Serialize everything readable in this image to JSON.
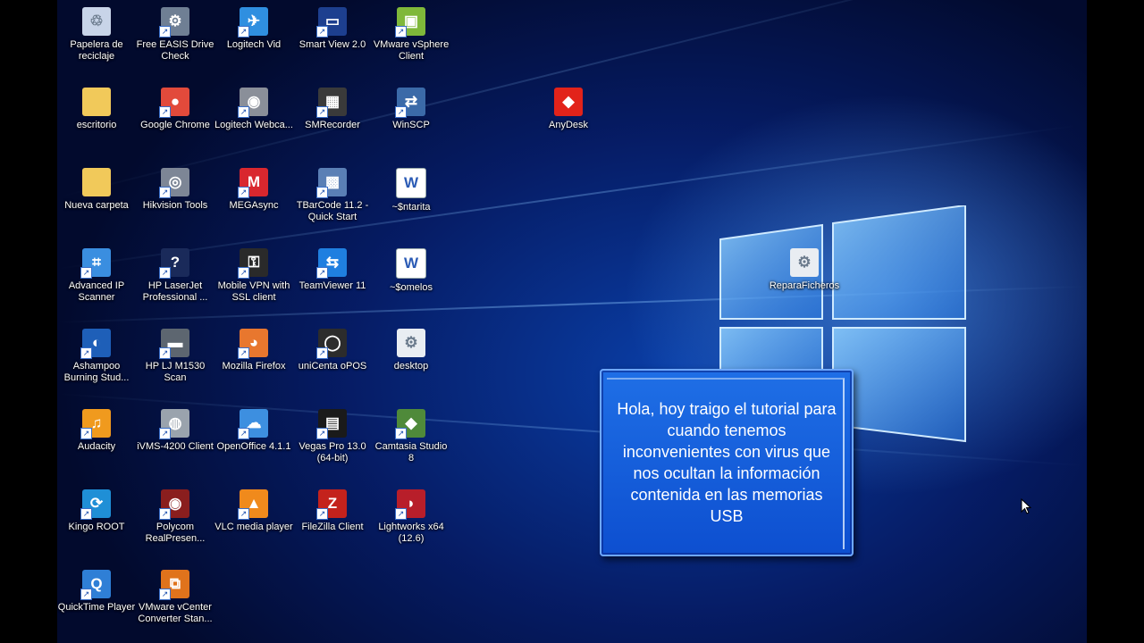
{
  "desktop": {
    "icons": [
      {
        "label": "Papelera de reciclaje",
        "icon": "recycle-bin-icon",
        "color": "#c8d4e8",
        "glyph": "♲",
        "shortcut": false
      },
      {
        "label": "Free EASIS Drive Check",
        "icon": "drive-check-icon",
        "color": "#6f7f94",
        "glyph": "⚙",
        "shortcut": true
      },
      {
        "label": "Logitech Vid",
        "icon": "logitech-vid-icon",
        "color": "#2f8fe0",
        "glyph": "✈",
        "shortcut": true
      },
      {
        "label": "Smart View 2.0",
        "icon": "smart-view-icon",
        "color": "#1d3f8f",
        "glyph": "▭",
        "shortcut": true
      },
      {
        "label": "VMware vSphere Client",
        "icon": "vsphere-icon",
        "color": "#7fb83a",
        "glyph": "▣",
        "shortcut": true
      },
      {
        "label": "escritorio",
        "icon": "folder-icon",
        "color": "#f1c95a",
        "glyph": "",
        "shortcut": false
      },
      {
        "label": "Google Chrome",
        "icon": "chrome-icon",
        "color": "#e24a3b",
        "glyph": "●",
        "shortcut": true
      },
      {
        "label": "Logitech Webca...",
        "icon": "webcam-icon",
        "color": "#8a8f99",
        "glyph": "◉",
        "shortcut": true
      },
      {
        "label": "SMRecorder",
        "icon": "smrecorder-icon",
        "color": "#3a3a3a",
        "glyph": "▦",
        "shortcut": true
      },
      {
        "label": "WinSCP",
        "icon": "winscp-icon",
        "color": "#3b6aa8",
        "glyph": "⇄",
        "shortcut": true
      },
      {
        "label": "Nueva carpeta",
        "icon": "folder-icon",
        "color": "#f1c95a",
        "glyph": "",
        "shortcut": false
      },
      {
        "label": "Hikvision Tools",
        "icon": "hikvision-icon",
        "color": "#7d8696",
        "glyph": "◎",
        "shortcut": true
      },
      {
        "label": "MEGAsync",
        "icon": "mega-icon",
        "color": "#d9272e",
        "glyph": "M",
        "shortcut": true
      },
      {
        "label": "TBarCode 11.2 - Quick Start",
        "icon": "barcode-icon",
        "color": "#5a7fb5",
        "glyph": "▩",
        "shortcut": true
      },
      {
        "label": "~$ntarita",
        "icon": "word-doc-icon",
        "color": "#ffffff",
        "glyph": "W",
        "shortcut": false
      },
      {
        "label": "Advanced IP Scanner",
        "icon": "ip-scanner-icon",
        "color": "#3a8ee0",
        "glyph": "⌗",
        "shortcut": true
      },
      {
        "label": "HP LaserJet Professional ...",
        "icon": "hp-laserjet-icon",
        "color": "#1a2a5a",
        "glyph": "?",
        "shortcut": true
      },
      {
        "label": "Mobile VPN with SSL client",
        "icon": "vpn-icon",
        "color": "#2a2a2a",
        "glyph": "⚿",
        "shortcut": true
      },
      {
        "label": "TeamViewer 11",
        "icon": "teamviewer-icon",
        "color": "#1f7fe0",
        "glyph": "⇆",
        "shortcut": true
      },
      {
        "label": "~$omelos",
        "icon": "word-doc-icon",
        "color": "#ffffff",
        "glyph": "W",
        "shortcut": false
      },
      {
        "label": "Ashampoo Burning Stud...",
        "icon": "ashampoo-icon",
        "color": "#1e5fb8",
        "glyph": "◐",
        "shortcut": true
      },
      {
        "label": "HP LJ M1530 Scan",
        "icon": "hp-scan-icon",
        "color": "#5d6670",
        "glyph": "▬",
        "shortcut": true
      },
      {
        "label": "Mozilla Firefox",
        "icon": "firefox-icon",
        "color": "#e8772e",
        "glyph": "◕",
        "shortcut": true
      },
      {
        "label": "uniCenta oPOS",
        "icon": "unicenta-icon",
        "color": "#2c2c2c",
        "glyph": "◯",
        "shortcut": true
      },
      {
        "label": "desktop",
        "icon": "settings-file-icon",
        "color": "#e9edf2",
        "glyph": "⚙",
        "shortcut": false
      },
      {
        "label": "Audacity",
        "icon": "audacity-icon",
        "color": "#f09a1e",
        "glyph": "♫",
        "shortcut": true
      },
      {
        "label": "iVMS-4200 Client",
        "icon": "ivms-icon",
        "color": "#9aa3ad",
        "glyph": "◍",
        "shortcut": true
      },
      {
        "label": "OpenOffice 4.1.1",
        "icon": "openoffice-icon",
        "color": "#3d8fe0",
        "glyph": "☁",
        "shortcut": true
      },
      {
        "label": "Vegas Pro 13.0 (64-bit)",
        "icon": "vegas-icon",
        "color": "#1a1a1a",
        "glyph": "▤",
        "shortcut": true
      },
      {
        "label": "Camtasia Studio 8",
        "icon": "camtasia-icon",
        "color": "#4f8a3a",
        "glyph": "◆",
        "shortcut": true
      },
      {
        "label": "Kingo ROOT",
        "icon": "kingo-root-icon",
        "color": "#1f8fd6",
        "glyph": "⟳",
        "shortcut": true
      },
      {
        "label": "Polycom RealPresen...",
        "icon": "polycom-icon",
        "color": "#8a1e1e",
        "glyph": "◉",
        "shortcut": true
      },
      {
        "label": "VLC media player",
        "icon": "vlc-icon",
        "color": "#f08a1c",
        "glyph": "▲",
        "shortcut": true
      },
      {
        "label": "FileZilla Client",
        "icon": "filezilla-icon",
        "color": "#c4221c",
        "glyph": "Z",
        "shortcut": true
      },
      {
        "label": "Lightworks x64 (12.6)",
        "icon": "lightworks-icon",
        "color": "#b81e2a",
        "glyph": "◗",
        "shortcut": true
      },
      {
        "label": "QuickTime Player",
        "icon": "quicktime-icon",
        "color": "#2f7fd6",
        "glyph": "Q",
        "shortcut": true
      },
      {
        "label": "VMware vCenter Converter Stan...",
        "icon": "vcenter-converter-icon",
        "color": "#e0731c",
        "glyph": "⧉",
        "shortcut": true
      },
      {
        "label": "AnyDesk",
        "icon": "anydesk-icon",
        "color": "#e2231a",
        "glyph": "◆",
        "shortcut": false
      },
      {
        "label": "ReparaFicheros",
        "icon": "settings-file-icon",
        "color": "#e9edf2",
        "glyph": "⚙",
        "shortcut": false
      }
    ]
  },
  "tutorial": {
    "text": "Hola, hoy traigo el tutorial para cuando tenemos inconvenientes con virus que nos ocultan la información contenida en las memorias USB"
  }
}
